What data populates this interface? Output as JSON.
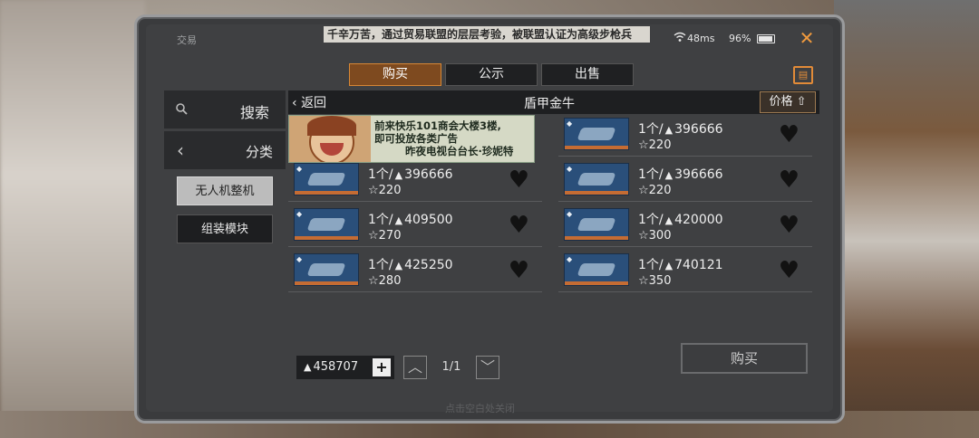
{
  "status_bar": {
    "title": "交易",
    "ticker": "千辛万苦，通过贸易联盟的层层考验，被联盟认证为高级步枪兵",
    "ping": "48ms",
    "battery": "96%"
  },
  "tabs": [
    {
      "label": "购买",
      "active": true
    },
    {
      "label": "公示",
      "active": false
    },
    {
      "label": "出售",
      "active": false
    }
  ],
  "sidebar": {
    "search_label": "搜索",
    "category_label": "分类",
    "items": [
      {
        "label": "无人机整机",
        "selected": true
      },
      {
        "label": "组装模块",
        "selected": false
      }
    ]
  },
  "content": {
    "back_label": "返回",
    "title": "盾甲金牛",
    "sort_label": "价格"
  },
  "ad": {
    "line1": "前来快乐101商会大楼3楼,",
    "line2": "即可投放各类广告",
    "line3": "昨夜电视台台长·珍妮特"
  },
  "listings": [
    {
      "qty": "1个/",
      "price": "396666",
      "level": "220"
    },
    {
      "qty": "1个/",
      "price": "396666",
      "level": "220"
    },
    {
      "qty": "1个/",
      "price": "396666",
      "level": "220"
    },
    {
      "qty": "1个/",
      "price": "409500",
      "level": "270"
    },
    {
      "qty": "1个/",
      "price": "420000",
      "level": "300"
    },
    {
      "qty": "1个/",
      "price": "425250",
      "level": "280"
    },
    {
      "qty": "1个/",
      "price": "740121",
      "level": "350"
    }
  ],
  "footer": {
    "balance": "458707",
    "page": "1/1",
    "buy_label": "购买",
    "hint": "点击空白处关闭"
  },
  "colors": {
    "accent": "#d78735",
    "active_tab_bg": "#7e4a1f",
    "panel_bg": "#3f4042"
  }
}
